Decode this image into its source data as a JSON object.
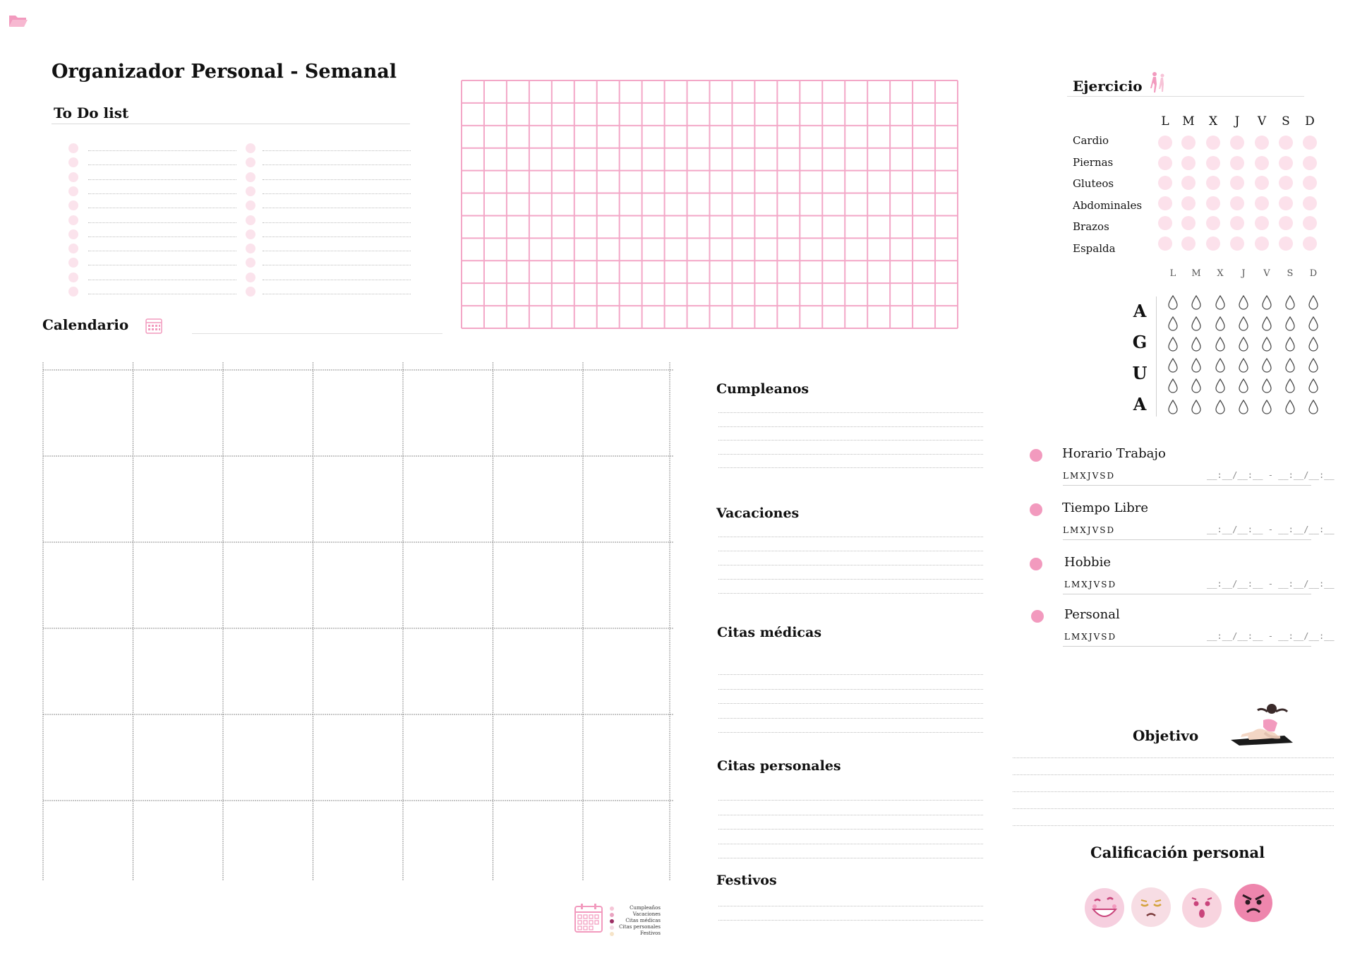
{
  "header": {
    "title": "Organizador Personal - Semanal",
    "folder_icon": "folder-icon"
  },
  "todo": {
    "title": "To Do list"
  },
  "calendar": {
    "title": "Calendario",
    "icon": "calendar-icon"
  },
  "exercise": {
    "title": "Ejercicio",
    "days": [
      "L",
      "M",
      "X",
      "J",
      "V",
      "S",
      "D"
    ],
    "rows": [
      "Cardio",
      "Piernas",
      "Gluteos",
      "Abdominales",
      "Brazos",
      "Espalda"
    ]
  },
  "water": {
    "days": [
      "L",
      "M",
      "X",
      "J",
      "V",
      "S",
      "D"
    ],
    "letters": [
      "A",
      "G",
      "U",
      "A"
    ]
  },
  "events": {
    "birthdays": "Cumpleanos",
    "vacations": "Vacaciones",
    "medical": "Citas médicas",
    "personal": "Citas personales",
    "holidays": "Festivos"
  },
  "schedule": [
    {
      "title": "Horario Trabajo",
      "days": "LMXJVSD",
      "time": "__:__/__:__ - __:__/__:__"
    },
    {
      "title": "Tiempo Libre",
      "days": "LMXJVSD",
      "time": "__:__/__:__ - __:__/__:__"
    },
    {
      "title": "Hobbie",
      "days": "LMXJVSD",
      "time": "__:__/__:__ - __:__/__:__"
    },
    {
      "title": "Personal",
      "days": "LMXJVSD",
      "time": "__:__/__:__ - __:__/__:__"
    }
  ],
  "objective": {
    "title": "Objetivo"
  },
  "rating": {
    "title": "Calificación personal",
    "faces": [
      "happy-face-icon",
      "sad-face-icon",
      "surprised-face-icon",
      "angry-face-icon"
    ]
  },
  "legend": {
    "items": [
      "Cumpleaños",
      "Vacaciones",
      "Citas médicas",
      "Citas personales",
      "Festivos"
    ],
    "colors": [
      "#f6c6d7",
      "#e9a3c0",
      "#9c2f64",
      "#f3d9e4",
      "#f6e4c8"
    ]
  },
  "colors": {
    "accent_pink": "#f29abe",
    "grid_pink": "#f3a7c7",
    "light_pink": "#fbe3ec"
  }
}
